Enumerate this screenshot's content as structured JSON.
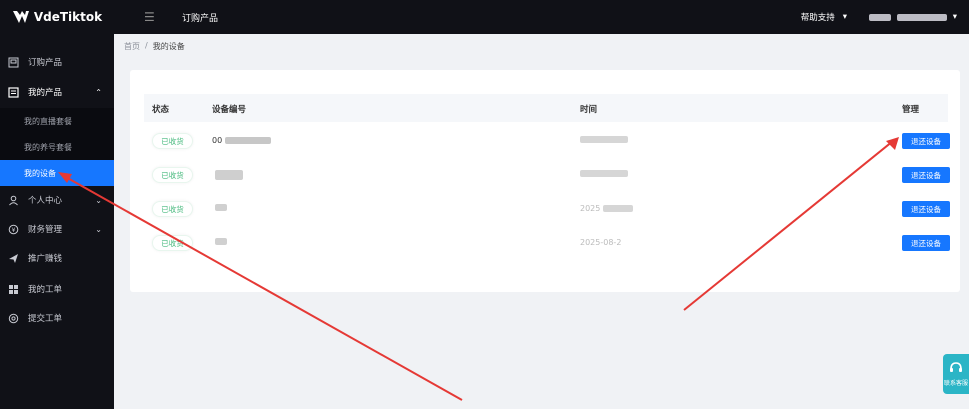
{
  "brand": {
    "name": "VdeTiktok"
  },
  "topbar": {
    "title": "订购产品",
    "help": "帮助支持"
  },
  "sidebar": {
    "items": [
      {
        "label": "订购产品",
        "icon": "store-icon"
      },
      {
        "label": "我的产品",
        "icon": "list-icon",
        "expanded": true,
        "children": [
          "我的直播套餐",
          "我的养号套餐",
          "我的设备"
        ]
      },
      {
        "label": "个人中心",
        "icon": "user-icon"
      },
      {
        "label": "财务管理",
        "icon": "finance-icon"
      },
      {
        "label": "推广赚钱",
        "icon": "send-icon"
      },
      {
        "label": "我的工单",
        "icon": "grid-icon"
      },
      {
        "label": "提交工单",
        "icon": "settings-icon"
      }
    ],
    "active_child": "我的设备"
  },
  "breadcrumb": {
    "home": "首页",
    "sep": "/",
    "current": "我的设备"
  },
  "table": {
    "headers": [
      "状态",
      "设备编号",
      "时间",
      "管理"
    ],
    "rows": [
      {
        "status": "已收货",
        "device_id": "00",
        "time": "",
        "action": "退还设备"
      },
      {
        "status": "已收货",
        "device_id": "",
        "time": "",
        "action": "退还设备"
      },
      {
        "status": "已收货",
        "device_id": "",
        "time": "2025",
        "action": "退还设备"
      },
      {
        "status": "已收货",
        "device_id": "",
        "time": "2025-08-2",
        "action": "退还设备"
      }
    ]
  },
  "support_widget": {
    "label": "联系客服"
  },
  "colors": {
    "primary": "#1677ff",
    "sidebar_bg": "#101117",
    "status_green": "#45b97c",
    "annotation_red": "#e53935"
  }
}
